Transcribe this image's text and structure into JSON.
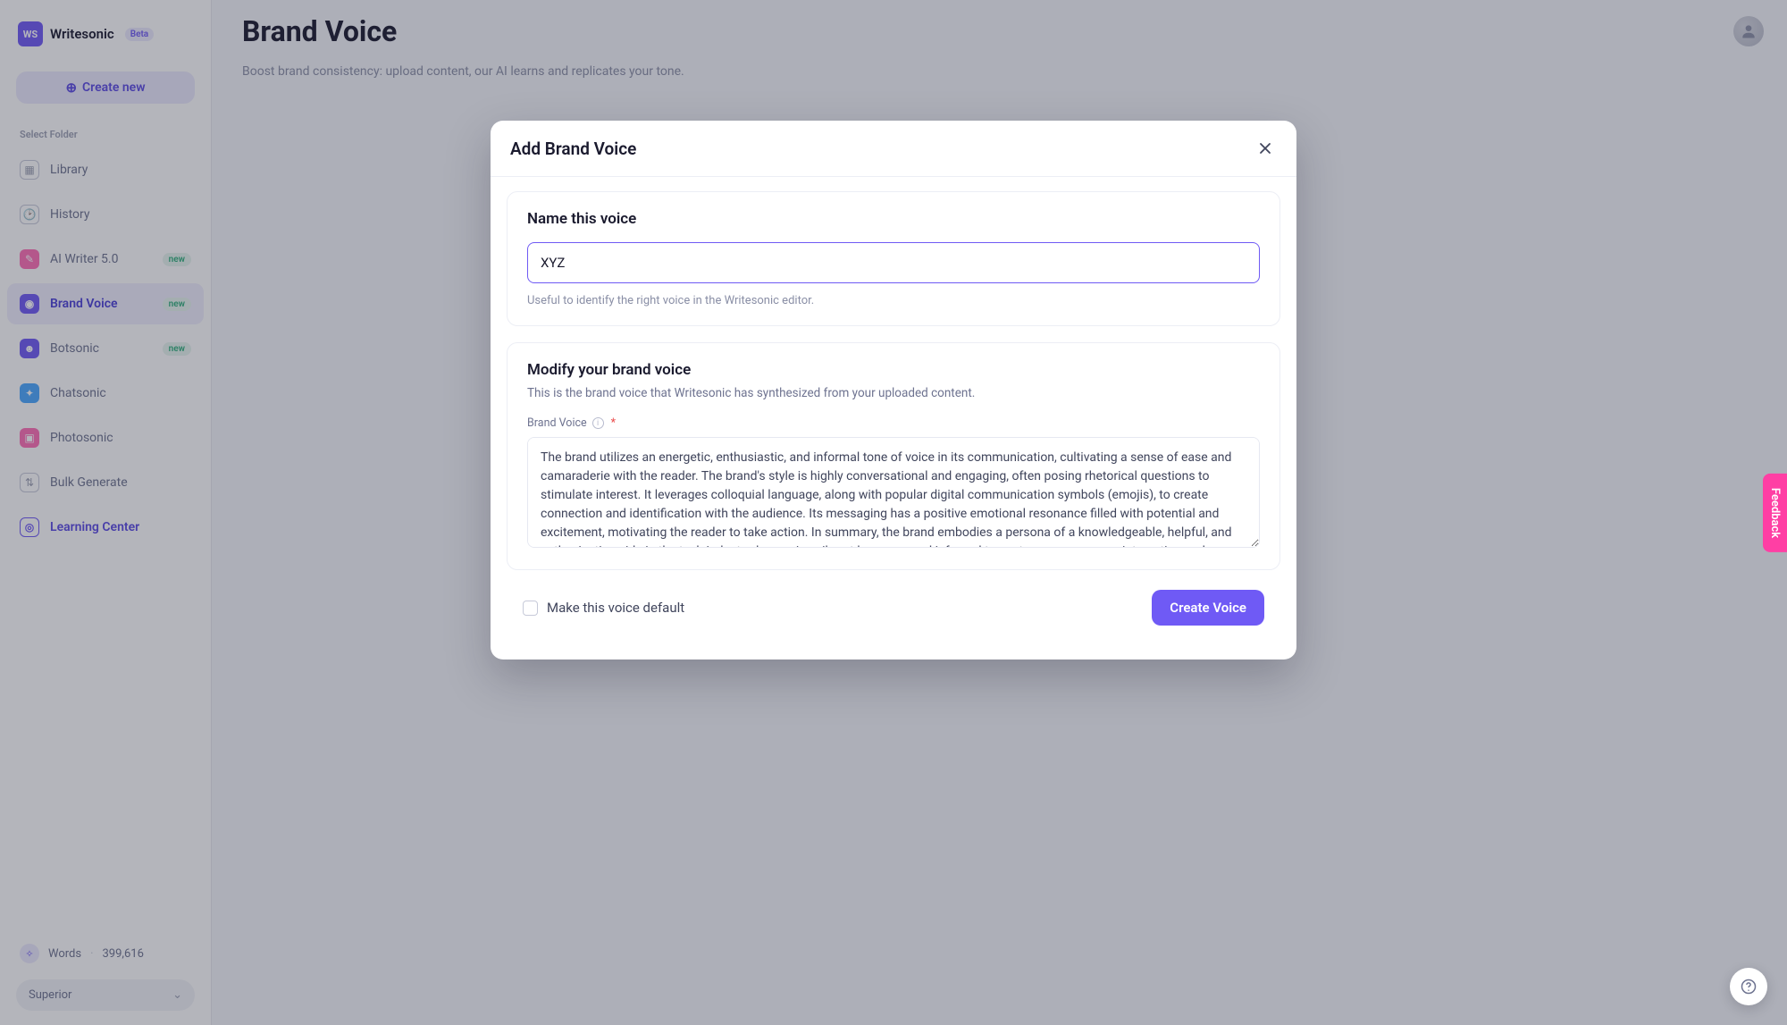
{
  "brand": {
    "logo_text": "WS",
    "name": "Writesonic",
    "badge": "Beta"
  },
  "create_button": "Create new",
  "select_folder_label": "Select Folder",
  "sidebar": {
    "items": [
      {
        "label": "Library"
      },
      {
        "label": "History"
      },
      {
        "label": "AI Writer 5.0",
        "badge": "new"
      },
      {
        "label": "Brand Voice",
        "badge": "new"
      },
      {
        "label": "Botsonic",
        "badge": "new"
      },
      {
        "label": "Chatsonic"
      },
      {
        "label": "Photosonic"
      },
      {
        "label": "Bulk Generate"
      },
      {
        "label": "Learning Center"
      }
    ]
  },
  "footer": {
    "words_label": "Words",
    "words_count": "399,616",
    "plan": "Superior"
  },
  "page": {
    "title": "Brand Voice",
    "subtitle": "Boost brand consistency: upload content, our AI learns and replicates your tone."
  },
  "modal": {
    "title": "Add Brand Voice",
    "name_section": {
      "heading": "Name this voice",
      "value": "XYZ",
      "hint": "Useful to identify the right voice in the Writesonic editor."
    },
    "voice_section": {
      "heading": "Modify your brand voice",
      "sub": "This is the brand voice that Writesonic has synthesized from your uploaded content.",
      "field_label": "Brand Voice",
      "textarea_value": "The brand utilizes an energetic, enthusiastic, and informal tone of voice in its communication, cultivating a sense of ease and camaraderie with the reader. The brand's style is highly conversational and engaging, often posing rhetorical questions to stimulate interest. It leverages colloquial language, along with popular digital communication symbols (emojis), to create connection and identification with the audience. Its messaging has a positive emotional resonance filled with potential and excitement, motivating the reader to take action. In summary, the brand embodies a persona of a knowledgeable, helpful, and enthusiastic guide in the tech industry, leveraging vibrant language and informal tones to encourage user interaction and engagement."
    },
    "default_label": "Make this voice default",
    "create_label": "Create Voice"
  },
  "feedback_label": "Feedback"
}
